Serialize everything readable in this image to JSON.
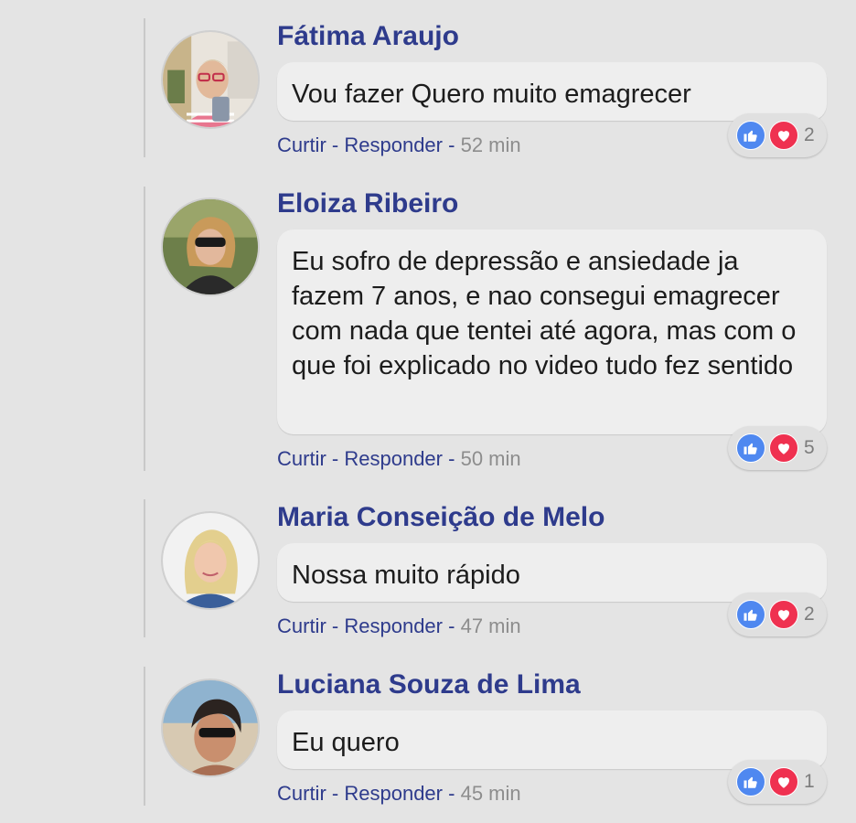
{
  "action_labels": {
    "like": "Curtir",
    "separator": "-",
    "reply": "Responder"
  },
  "colors": {
    "author": "#2e3b8c",
    "like": "#4f88f0",
    "love": "#ef3150",
    "time": "#8d8d8d"
  },
  "comments": [
    {
      "author": "Fátima Araujo",
      "text": "Vou fazer Quero muito emagrecer",
      "time": "52 min",
      "reaction_icons": [
        "thumbs-up-icon",
        "heart-icon"
      ],
      "reaction_count": "2"
    },
    {
      "author": "Eloiza Ribeiro",
      "text": "Eu sofro de depressão e ansiedade ja fazem 7 anos, e nao consegui emagrecer com nada que tentei até agora, mas com o que foi explicado no video tudo fez sentido",
      "time": "50 min",
      "reaction_icons": [
        "thumbs-up-icon",
        "heart-icon"
      ],
      "reaction_count": "5"
    },
    {
      "author": "Maria Conseição de Melo",
      "text": "Nossa muito rápido",
      "time": "47 min",
      "reaction_icons": [
        "thumbs-up-icon",
        "heart-icon"
      ],
      "reaction_count": "2"
    },
    {
      "author": "Luciana Souza de Lima",
      "text": "Eu quero",
      "time": "45 min",
      "reaction_icons": [
        "thumbs-up-icon",
        "heart-icon"
      ],
      "reaction_count": "1"
    }
  ]
}
